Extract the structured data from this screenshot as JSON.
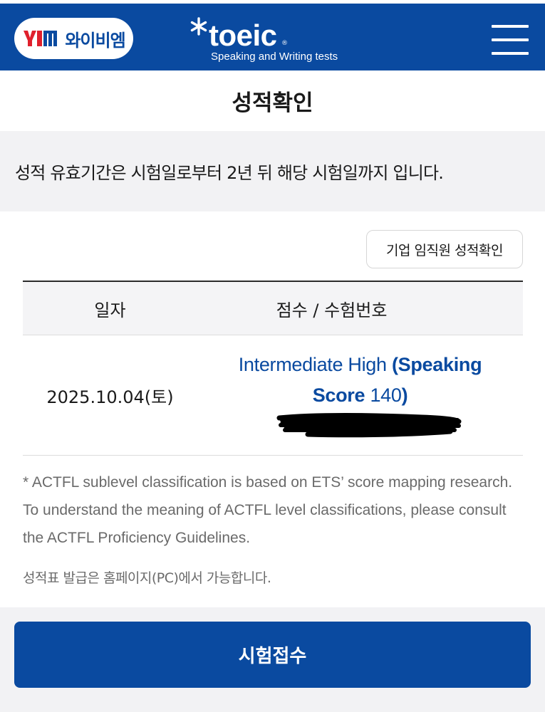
{
  "header": {
    "partner_logo_text": "와이비엠",
    "brand_name": "toeic",
    "brand_registered": "®",
    "brand_subtitle": "Speaking and Writing tests",
    "colors": {
      "header_bg": "#0a4aa0",
      "logo_red": "#e0202c"
    }
  },
  "page": {
    "title": "성적확인",
    "validity_notice": "성적 유효기간은 시험일로부터 2년 뒤 해당 시험일까지 입니다."
  },
  "corporate_check_label": "기업 임직원 성적확인",
  "table": {
    "headers": {
      "date": "일자",
      "score": "점수 / 수험번호"
    },
    "rows": [
      {
        "date": "2025.10.04(토)",
        "level": "Intermediate High",
        "open_paren": "(",
        "score_label_1": "Speaking",
        "score_label_2": "Score",
        "score_value": "140",
        "close_paren": ")"
      }
    ]
  },
  "footnotes": {
    "actfl": "* ACTFL sublevel classification is based on ETS’ score mapping research. To understand the meaning of ACTFL level classifications, please consult the ACTFL Proficiency Guidelines.",
    "issuance": "성적표 발급은 홈페이지(PC)에서 가능합니다."
  },
  "cta": {
    "label": "시험접수"
  },
  "icons": [
    "ybm-logo-icon",
    "toeic-asterisk-icon",
    "hamburger-menu-icon"
  ]
}
